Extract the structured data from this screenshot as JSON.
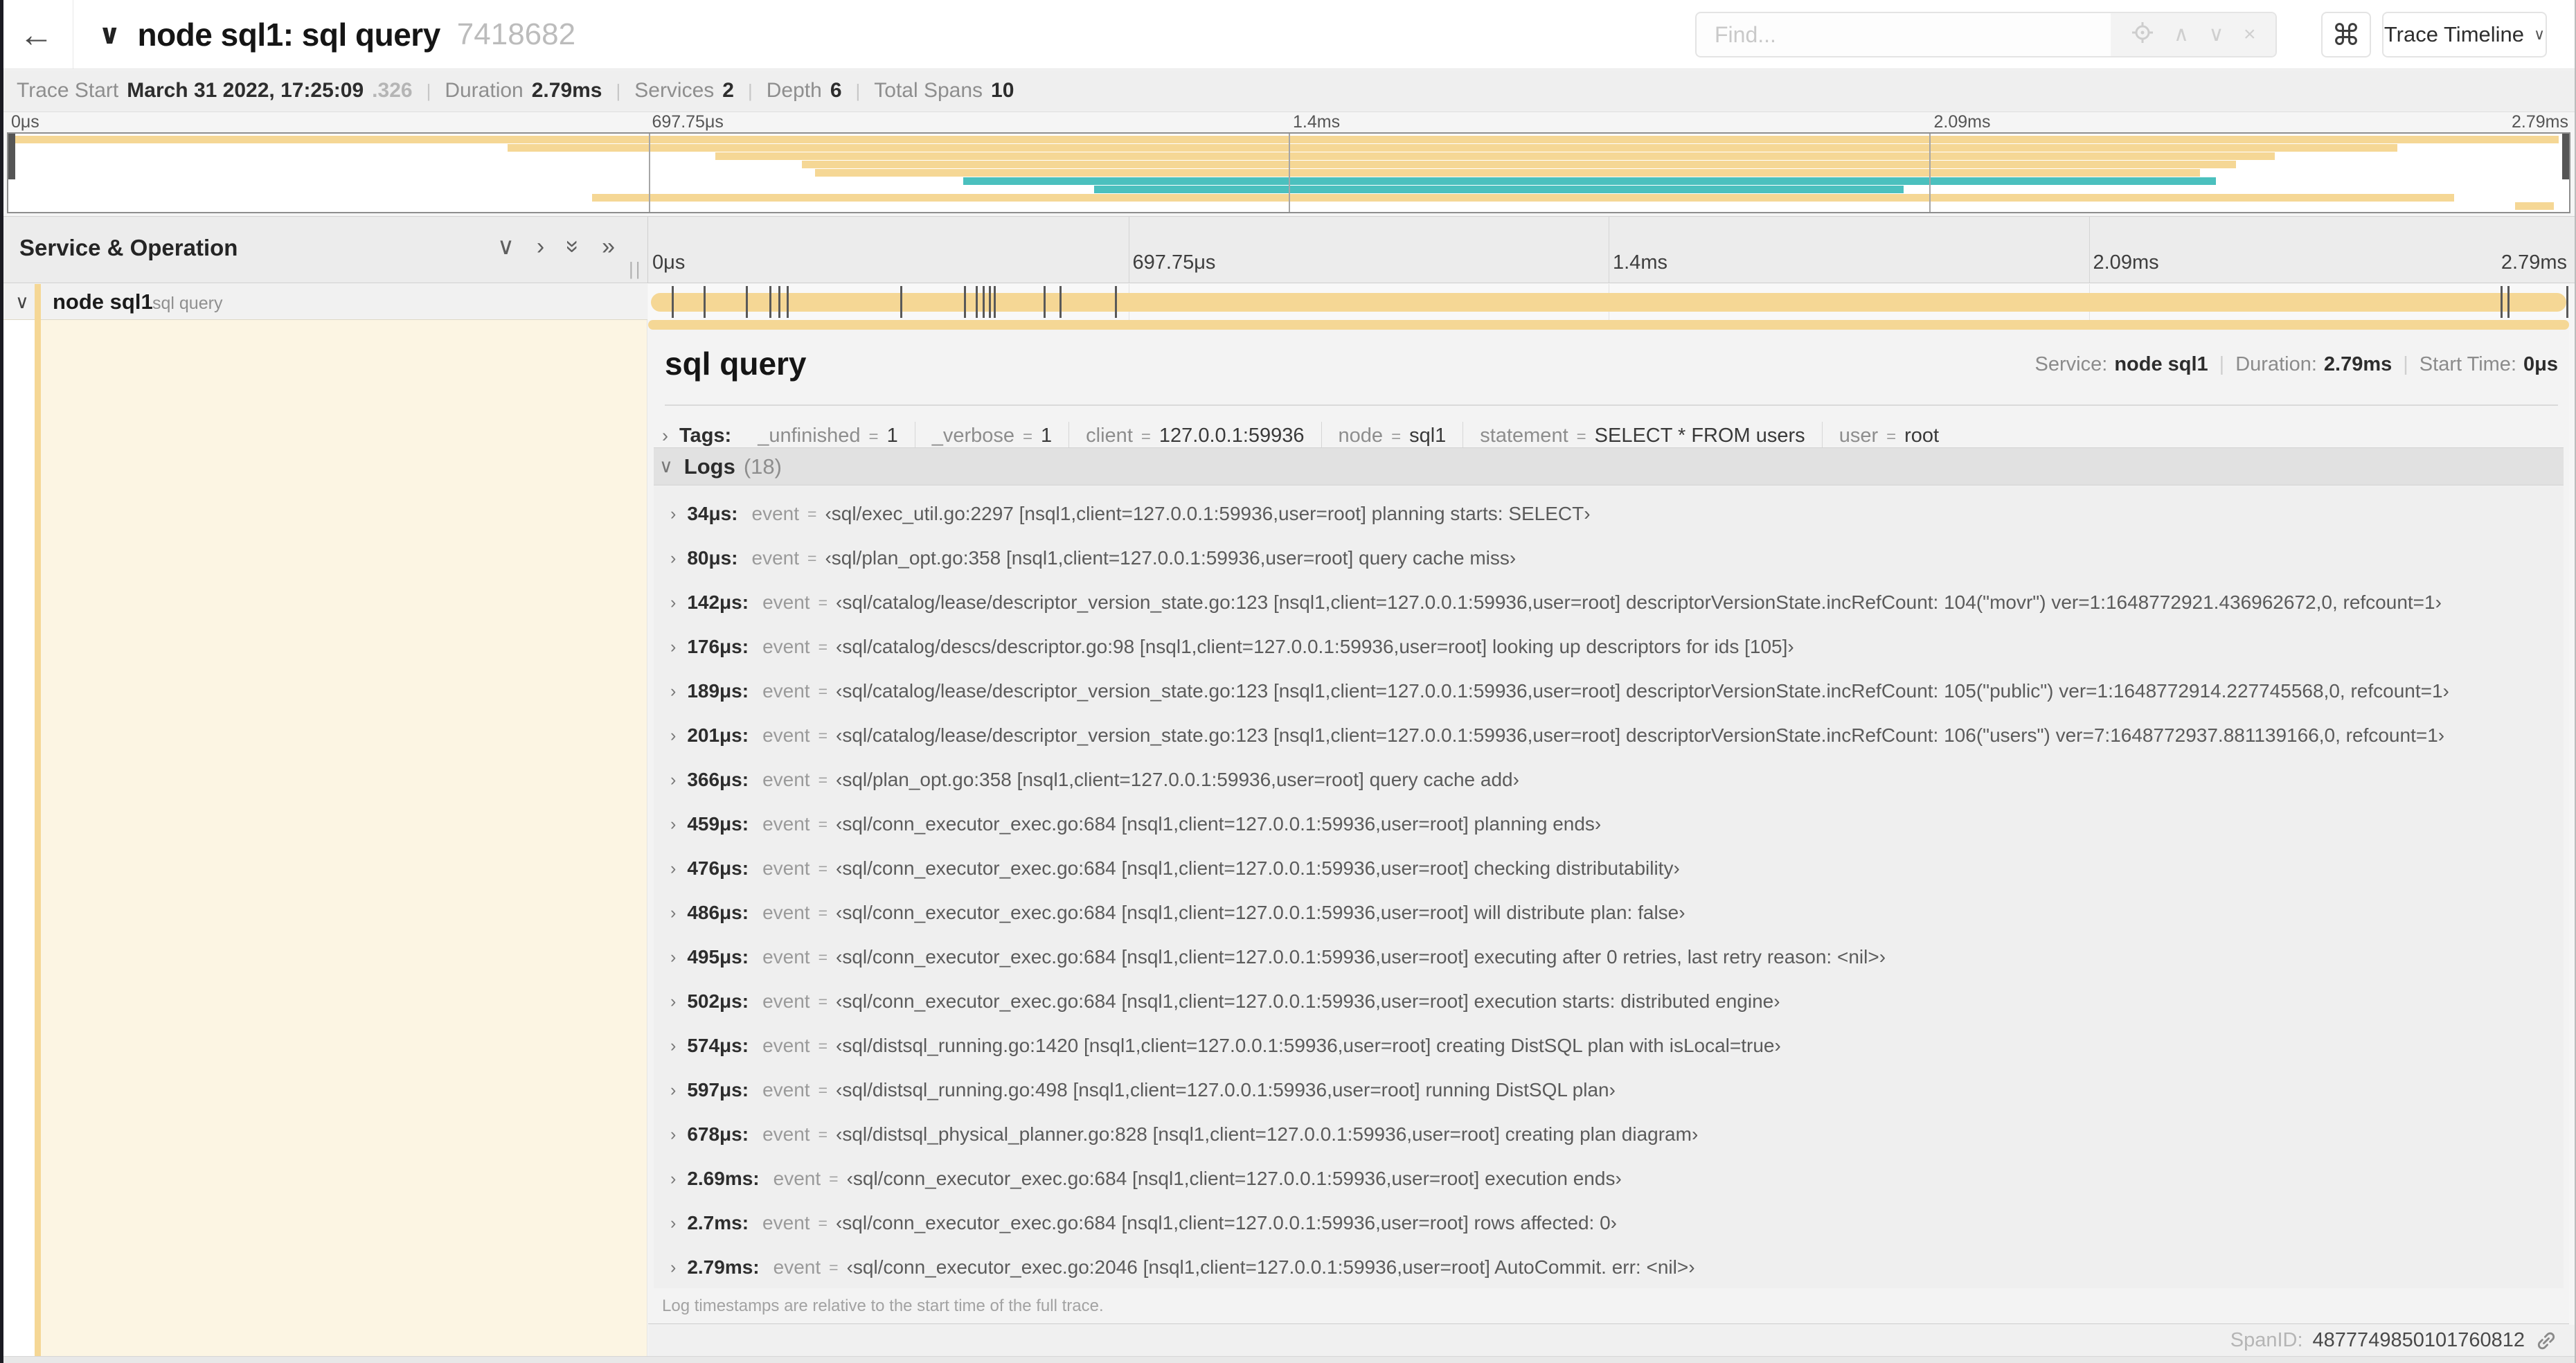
{
  "icons": {
    "back": "←",
    "chevron_down": "∨",
    "chevron_right": "›",
    "double_chevron_right": "»",
    "find_prev": "∧",
    "find_next": "∨",
    "clear": "×",
    "command": "⌘",
    "drag_grip": "||"
  },
  "colors": {
    "span_tan": "#F5D795",
    "span_teal": "#4BC0BE",
    "row_highlight": "#FCF5E3",
    "marker": "#595959"
  },
  "topbar": {
    "title": "node sql1: sql query",
    "trace_id": "7418682",
    "find": {
      "placeholder": "Find..."
    },
    "view_dropdown": {
      "label": "Trace Timeline"
    }
  },
  "summary": {
    "items": [
      {
        "label": "Trace Start",
        "value": "March 31 2022, 17:25:09",
        "suffix": ".326"
      },
      {
        "label": "Duration",
        "value": "2.79ms"
      },
      {
        "label": "Services",
        "value": "2"
      },
      {
        "label": "Depth",
        "value": "6"
      },
      {
        "label": "Total Spans",
        "value": "10"
      }
    ]
  },
  "timeline": {
    "total_us": 2790,
    "ticks": [
      {
        "label": "0μs",
        "pct": 0
      },
      {
        "label": "697.75μs",
        "pct": 25
      },
      {
        "label": "1.4ms",
        "pct": 50
      },
      {
        "label": "2.09ms",
        "pct": 75
      },
      {
        "label": "2.79ms",
        "pct": 100
      }
    ]
  },
  "minimap": {
    "spans": [
      {
        "start_pct": 0,
        "end_pct": 99.6,
        "color": "#F5D795"
      },
      {
        "start_pct": 19.5,
        "end_pct": 93.3,
        "color": "#F5D795"
      },
      {
        "start_pct": 27.6,
        "end_pct": 88.5,
        "color": "#F5D795"
      },
      {
        "start_pct": 31.0,
        "end_pct": 87.0,
        "color": "#F5D795"
      },
      {
        "start_pct": 31.5,
        "end_pct": 85.6,
        "color": "#F5D795"
      },
      {
        "start_pct": 37.3,
        "end_pct": 86.2,
        "color": "#4BC0BE"
      },
      {
        "start_pct": 42.4,
        "end_pct": 74.0,
        "color": "#4BC0BE"
      },
      {
        "start_pct": 22.8,
        "end_pct": 95.5,
        "color": "#F5D795"
      },
      {
        "start_pct": 97.9,
        "end_pct": 99.4,
        "color": "#F5D795"
      }
    ]
  },
  "span_table": {
    "header_left": "Service & Operation",
    "row": {
      "service": "node sql1",
      "operation": "sql query",
      "log_markers_us": [
        34,
        80,
        142,
        176,
        189,
        201,
        366,
        459,
        476,
        486,
        495,
        502,
        574,
        597,
        678,
        2690,
        2700,
        2790
      ]
    }
  },
  "detail": {
    "operation": "sql query",
    "meta": {
      "service_label": "Service:",
      "service": "node sql1",
      "duration_label": "Duration:",
      "duration": "2.79ms",
      "start_label": "Start Time:",
      "start": "0μs"
    },
    "tags_label": "Tags:",
    "tags": [
      {
        "key": "_unfinished",
        "value": "1"
      },
      {
        "key": "_verbose",
        "value": "1"
      },
      {
        "key": "client",
        "value": "127.0.0.1:59936"
      },
      {
        "key": "node",
        "value": "sql1"
      },
      {
        "key": "statement",
        "value": "SELECT * FROM users"
      },
      {
        "key": "user",
        "value": "root"
      }
    ],
    "logs_label": "Logs",
    "logs_count": "(18)",
    "logs": [
      {
        "time": "34μs:",
        "field": "event",
        "value": "‹sql/exec_util.go:2297 [nsql1,client=127.0.0.1:59936,user=root] planning starts: SELECT›"
      },
      {
        "time": "80μs:",
        "field": "event",
        "value": "‹sql/plan_opt.go:358 [nsql1,client=127.0.0.1:59936,user=root] query cache miss›"
      },
      {
        "time": "142μs:",
        "field": "event",
        "value": "‹sql/catalog/lease/descriptor_version_state.go:123 [nsql1,client=127.0.0.1:59936,user=root] descriptorVersionState.incRefCount: 104(\"movr\") ver=1:1648772921.436962672,0, refcount=1›"
      },
      {
        "time": "176μs:",
        "field": "event",
        "value": "‹sql/catalog/descs/descriptor.go:98 [nsql1,client=127.0.0.1:59936,user=root] looking up descriptors for ids [105]›"
      },
      {
        "time": "189μs:",
        "field": "event",
        "value": "‹sql/catalog/lease/descriptor_version_state.go:123 [nsql1,client=127.0.0.1:59936,user=root] descriptorVersionState.incRefCount: 105(\"public\") ver=1:1648772914.227745568,0, refcount=1›"
      },
      {
        "time": "201μs:",
        "field": "event",
        "value": "‹sql/catalog/lease/descriptor_version_state.go:123 [nsql1,client=127.0.0.1:59936,user=root] descriptorVersionState.incRefCount: 106(\"users\") ver=7:1648772937.881139166,0, refcount=1›"
      },
      {
        "time": "366μs:",
        "field": "event",
        "value": "‹sql/plan_opt.go:358 [nsql1,client=127.0.0.1:59936,user=root] query cache add›"
      },
      {
        "time": "459μs:",
        "field": "event",
        "value": "‹sql/conn_executor_exec.go:684 [nsql1,client=127.0.0.1:59936,user=root] planning ends›"
      },
      {
        "time": "476μs:",
        "field": "event",
        "value": "‹sql/conn_executor_exec.go:684 [nsql1,client=127.0.0.1:59936,user=root] checking distributability›"
      },
      {
        "time": "486μs:",
        "field": "event",
        "value": "‹sql/conn_executor_exec.go:684 [nsql1,client=127.0.0.1:59936,user=root] will distribute plan: false›"
      },
      {
        "time": "495μs:",
        "field": "event",
        "value": "‹sql/conn_executor_exec.go:684 [nsql1,client=127.0.0.1:59936,user=root] executing after 0 retries, last retry reason: <nil>›"
      },
      {
        "time": "502μs:",
        "field": "event",
        "value": "‹sql/conn_executor_exec.go:684 [nsql1,client=127.0.0.1:59936,user=root] execution starts: distributed engine›"
      },
      {
        "time": "574μs:",
        "field": "event",
        "value": "‹sql/distsql_running.go:1420 [nsql1,client=127.0.0.1:59936,user=root] creating DistSQL plan with isLocal=true›"
      },
      {
        "time": "597μs:",
        "field": "event",
        "value": "‹sql/distsql_running.go:498 [nsql1,client=127.0.0.1:59936,user=root] running DistSQL plan›"
      },
      {
        "time": "678μs:",
        "field": "event",
        "value": "‹sql/distsql_physical_planner.go:828 [nsql1,client=127.0.0.1:59936,user=root] creating plan diagram›"
      },
      {
        "time": "2.69ms:",
        "field": "event",
        "value": "‹sql/conn_executor_exec.go:684 [nsql1,client=127.0.0.1:59936,user=root] execution ends›"
      },
      {
        "time": "2.7ms:",
        "field": "event",
        "value": "‹sql/conn_executor_exec.go:684 [nsql1,client=127.0.0.1:59936,user=root] rows affected: 0›"
      },
      {
        "time": "2.79ms:",
        "field": "event",
        "value": "‹sql/conn_executor_exec.go:2046 [nsql1,client=127.0.0.1:59936,user=root] AutoCommit. err: <nil>›"
      }
    ],
    "logs_note": "Log timestamps are relative to the start time of the full trace.",
    "footer": {
      "span_id_label": "SpanID:",
      "span_id": "4877749850101760812"
    }
  }
}
